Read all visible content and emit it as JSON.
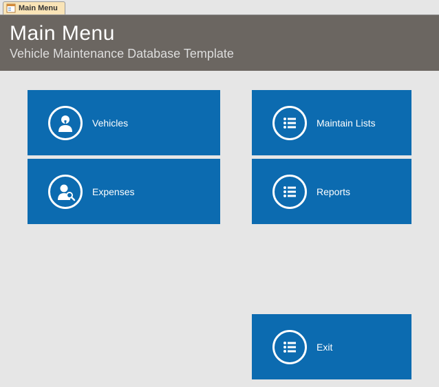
{
  "tab": {
    "label": "Main Menu"
  },
  "header": {
    "title": "Main Menu",
    "subtitle": "Vehicle Maintenance Database Template"
  },
  "tiles": {
    "vehicles": {
      "label": "Vehicles"
    },
    "expenses": {
      "label": "Expenses"
    },
    "maintain": {
      "label": "Maintain Lists"
    },
    "reports": {
      "label": "Reports"
    },
    "exit": {
      "label": "Exit"
    }
  },
  "colors": {
    "tile_bg": "#0c6bb0",
    "header_bg": "#6b6661"
  }
}
